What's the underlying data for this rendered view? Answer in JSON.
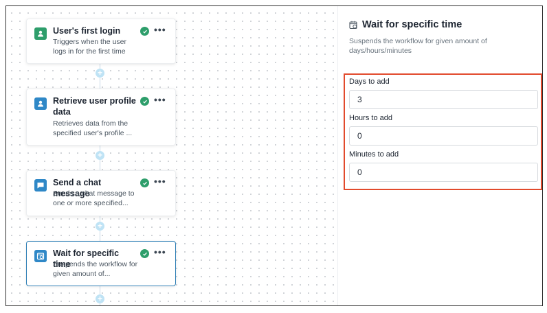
{
  "workflow": {
    "nodes": [
      {
        "title": "User's first login",
        "description": "Triggers when the user logs in for the first time",
        "icon": "user-icon",
        "icon_color": "#2e9e6b"
      },
      {
        "title": "Retrieve user profile data",
        "description": "Retrieves data from the specified user's profile ...",
        "icon": "user-icon",
        "icon_color": "#2f88c7"
      },
      {
        "title": "Send a chat message",
        "description": "Sends a chat message to one or more specified...",
        "icon": "chat-icon",
        "icon_color": "#2f88c7"
      },
      {
        "title": "Wait for specific time",
        "description": "Suspends the workflow for given amount of...",
        "icon": "calendar-clock-icon",
        "icon_color": "#2f88c7",
        "selected": true
      }
    ],
    "more_label": "•••",
    "add_label": "+"
  },
  "panel": {
    "title": "Wait for specific time",
    "description": "Suspends the workflow for given amount of days/hours/minutes",
    "fields": [
      {
        "label": "Days to add",
        "value": "3"
      },
      {
        "label": "Hours to add",
        "value": "0"
      },
      {
        "label": "Minutes to add",
        "value": "0"
      }
    ],
    "highlight_color": "#e24a2c"
  }
}
